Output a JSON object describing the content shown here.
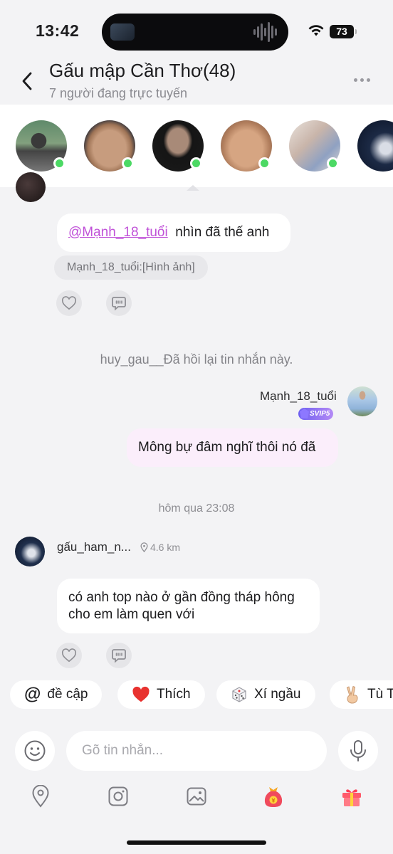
{
  "status_bar": {
    "time": "13:42",
    "battery": "73"
  },
  "header": {
    "title": "Gấu mập Cần Thơ(48)",
    "subtitle": "7 người đang trực tuyến"
  },
  "messages": {
    "reply": {
      "mention": "@Mạnh_18_tuổi",
      "text": "nhìn đã thế anh",
      "quote": "Mạnh_18_tuổi:[Hình ảnh]"
    },
    "system_note": "huy_gau__Đã hồi lại tin nhắn này.",
    "outgoing": {
      "sender": "Mạnh_18_tuổi",
      "badge": "SVIP5",
      "text": "Mông bự đâm nghĩ thôi nó đã"
    },
    "timestamp": "hôm qua 23:08",
    "incoming": {
      "sender": "gấu_ham_n...",
      "distance": "4.6 km",
      "text_line1": "có anh top nào ở gần đồng tháp hông",
      "text_line2": "cho em làm quen với"
    }
  },
  "quick_actions": [
    {
      "label": "đề cập",
      "icon": "at-icon"
    },
    {
      "label": "Thích",
      "icon": "heart-icon"
    },
    {
      "label": "Xí ngầu",
      "icon": "dice-icon"
    },
    {
      "label": "Tù T",
      "icon": "victory-hand-icon"
    }
  ],
  "composer": {
    "placeholder": "Gõ tin nhắn..."
  },
  "colors": {
    "background": "#f3f3f5",
    "mention": "#c052d8",
    "outgoing_bubble": "#fbeefb",
    "online": "#4cd964"
  }
}
